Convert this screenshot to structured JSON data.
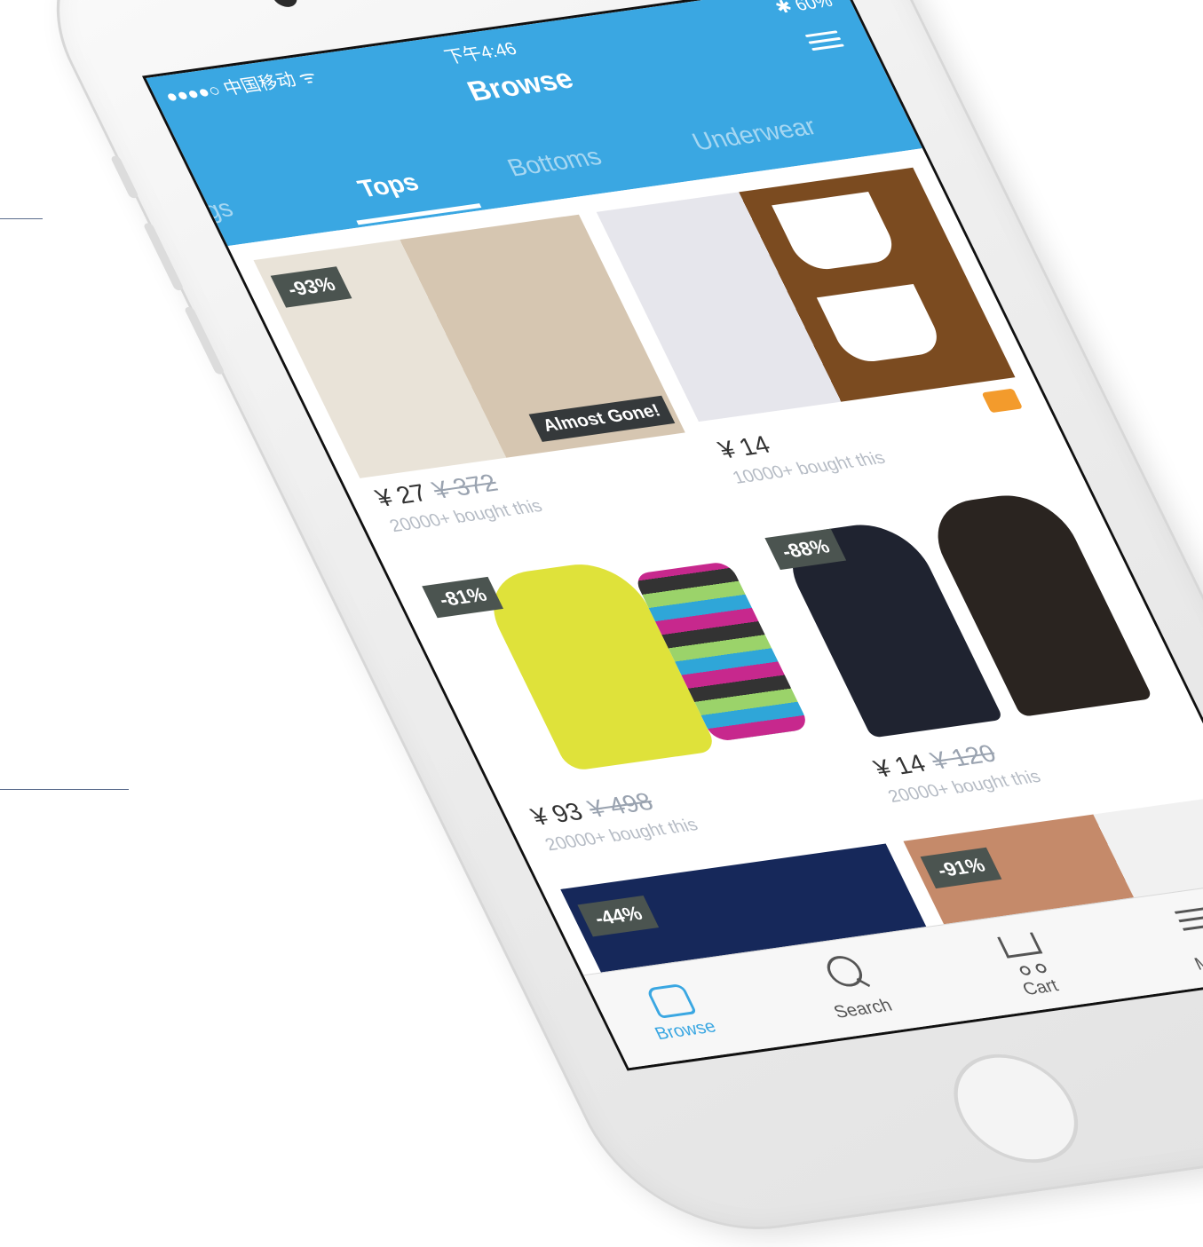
{
  "status_bar": {
    "carrier": "●●●●○ 中国移动 ᯤ",
    "time": "下午4:46",
    "battery": "✱ 60%"
  },
  "header": {
    "title": "Browse",
    "filter_icon": "sliders-icon"
  },
  "tabs": [
    "gs",
    "Tops",
    "Bottoms",
    "Underwear"
  ],
  "active_tab": "Tops",
  "products": [
    {
      "discount": "-93%",
      "tag": "Almost Gone!",
      "price": "¥ 27",
      "old_price": "¥ 372",
      "sold": "20000+ bought this",
      "img_top": "#e9e3d8",
      "img_bottom": "#b9a68a"
    },
    {
      "discount": "",
      "tag": "",
      "price": "¥ 14",
      "old_price": "",
      "sold": "10000+ bought this",
      "img_top": "#f0f0f0",
      "img_bottom": "#7b4b20",
      "truck_icon": "truck-icon"
    },
    {
      "discount": "-81%",
      "tag": "",
      "price": "¥ 93",
      "old_price": "¥ 498",
      "sold": "20000+ bought this",
      "img_top": "#ffffff",
      "img_bottom": "#dfe23a"
    },
    {
      "discount": "-88%",
      "tag": "",
      "price": "¥ 14",
      "old_price": "¥ 120",
      "sold": "20000+ bought this",
      "img_top": "#ffffff",
      "img_bottom": "#1f2330"
    },
    {
      "discount": "-44%",
      "tag": "",
      "price": "",
      "old_price": "",
      "sold": "",
      "img_top": "#16285a",
      "img_bottom": "#1d3a7a"
    },
    {
      "discount": "-91%",
      "tag": "",
      "price": "",
      "old_price": "",
      "sold": "",
      "img_top": "#c58a6a",
      "img_bottom": "#a65f45"
    }
  ],
  "bottom_nav": [
    {
      "label": "Browse",
      "icon": "home-icon",
      "active": true
    },
    {
      "label": "Search",
      "icon": "search-icon",
      "active": false
    },
    {
      "label": "Cart",
      "icon": "cart-icon",
      "active": false
    },
    {
      "label": "More",
      "icon": "menu-icon",
      "active": false
    }
  ],
  "colors": {
    "primary": "#3aa7e2",
    "badge": "#4b5450",
    "accent": "#f39b2c"
  }
}
